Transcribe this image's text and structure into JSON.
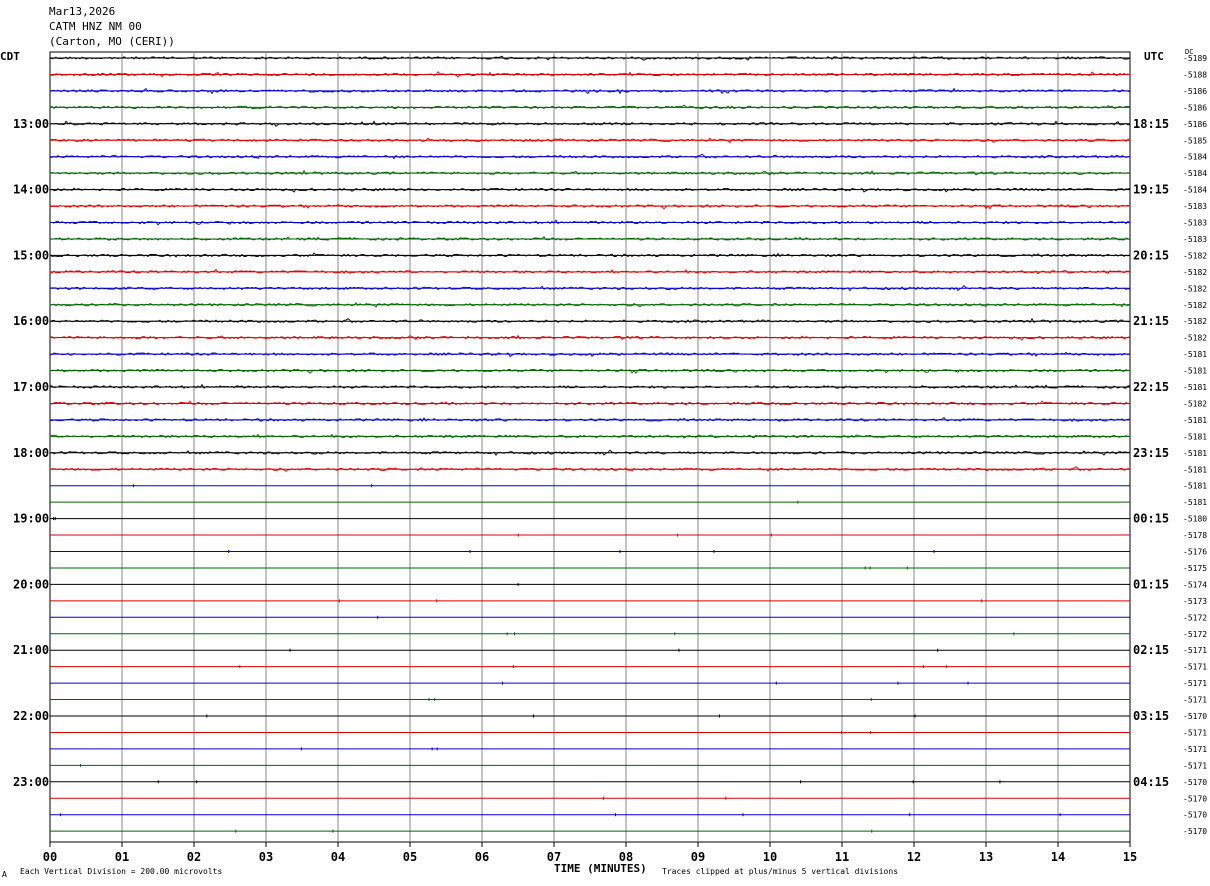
{
  "header": {
    "date": "Mar13,2026",
    "station": "CATM HNZ NM 00",
    "location": "(Carton, MO (CERI))"
  },
  "axis": {
    "left_label": "CDT",
    "right_label": "UTC",
    "dc_label": "DC",
    "xlabel": "TIME (MINUTES)",
    "scale_note": "Each Vertical Division =  200.00 microvolts",
    "clip_note": "Traces clipped at plus/minus 5 vertical divisions",
    "corner_mark": "A"
  },
  "colors": {
    "trace_cycle": [
      "#000000",
      "#dd0000",
      "#0000cc",
      "#006600"
    ],
    "grid": "#888888"
  },
  "chart_data": {
    "type": "line",
    "title": "",
    "x_ticks": [
      "00",
      "01",
      "02",
      "03",
      "04",
      "05",
      "06",
      "07",
      "08",
      "09",
      "10",
      "11",
      "12",
      "13",
      "14",
      "15"
    ],
    "xlim": [
      0,
      15
    ],
    "left_hour_labels": [
      "13:00",
      "14:00",
      "15:00",
      "16:00",
      "17:00",
      "18:00",
      "19:00",
      "20:00",
      "21:00",
      "22:00",
      "23:00"
    ],
    "right_hour_labels": [
      "18:15",
      "19:15",
      "20:15",
      "21:15",
      "22:15",
      "23:15",
      "00:15",
      "01:15",
      "02:15",
      "03:15",
      "04:15"
    ],
    "trace_count": 48,
    "active_trace_count": 26,
    "dc_offsets": [
      "-5189",
      "-5188",
      "-5186",
      "-5186",
      "-5186",
      "-5185",
      "-5184",
      "-5184",
      "-5184",
      "-5183",
      "-5183",
      "-5183",
      "-5182",
      "-5182",
      "-5182",
      "-5182",
      "-5182",
      "-5182",
      "-5181",
      "-5181",
      "-5181",
      "-5182",
      "-5181",
      "-5181",
      "-5181",
      "-5181",
      "-5181",
      "-5181",
      "-5180",
      "-5178",
      "-5176",
      "-5175",
      "-5174",
      "-5173",
      "-5172",
      "-5172",
      "-5171",
      "-5171",
      "-5171",
      "-5171",
      "-5170",
      "-5171",
      "-5171",
      "-5171",
      "-5170",
      "-5170",
      "-5170",
      "-5170"
    ]
  }
}
